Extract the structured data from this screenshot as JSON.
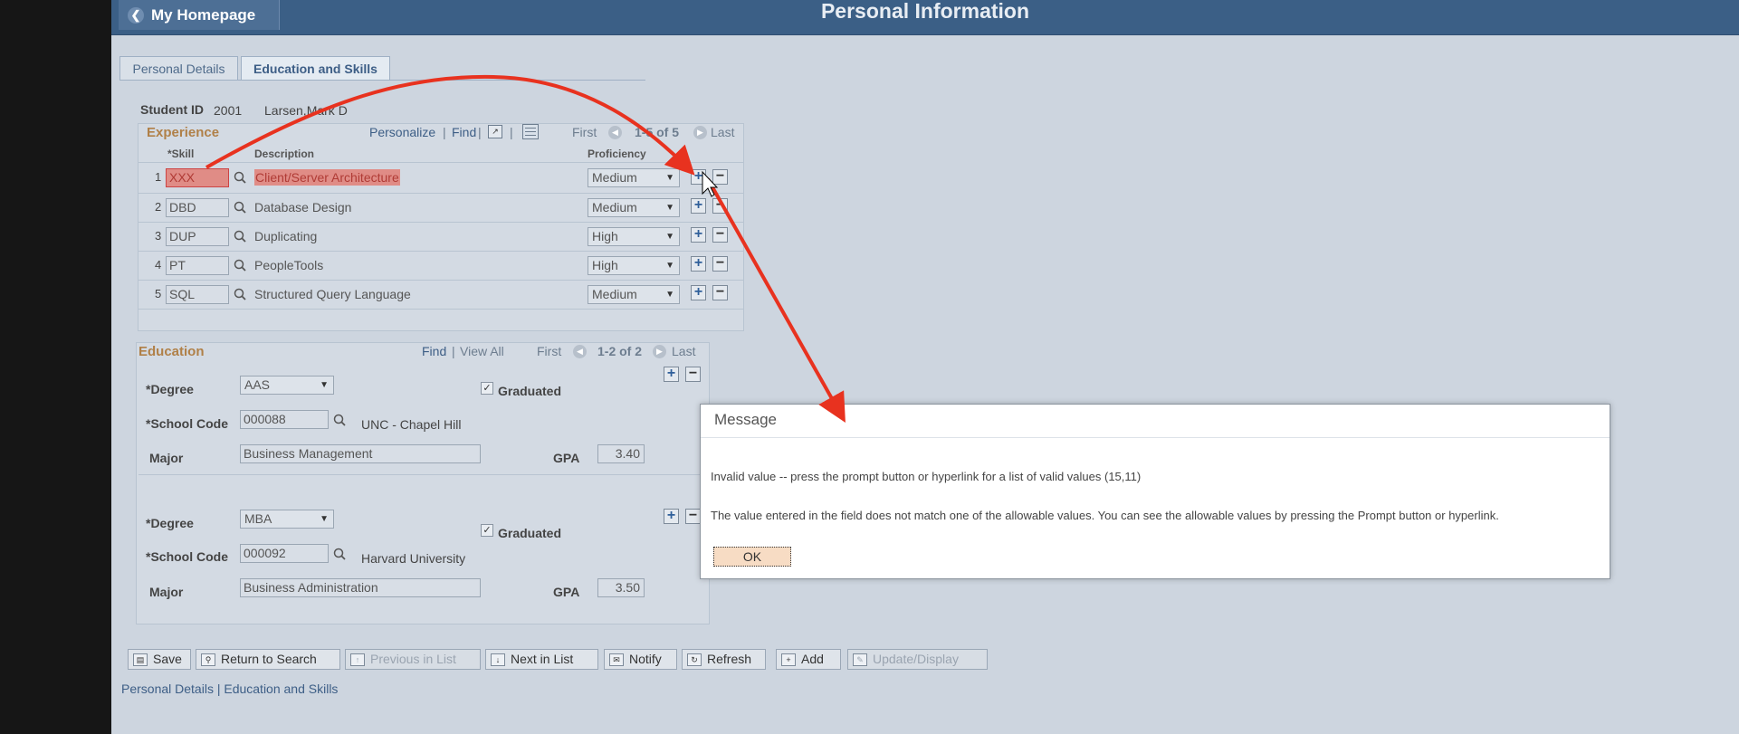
{
  "header": {
    "home_label": "My Homepage",
    "title": "Personal Information"
  },
  "tabs": [
    {
      "label": "Personal Details"
    },
    {
      "label": "Education and Skills"
    }
  ],
  "student": {
    "id_label": "Student ID",
    "id_value": "2001",
    "name": "Larsen,Mark D"
  },
  "experience": {
    "title": "Experience",
    "personalize": "Personalize",
    "find": "Find",
    "first": "First",
    "range": "1-5 of 5",
    "last": "Last",
    "col_skill": "*Skill",
    "col_description": "Description",
    "col_proficiency": "Proficiency",
    "rows": [
      {
        "num": "1",
        "skill": "XXX",
        "description": "Client/Server Architecture",
        "proficiency": "Medium"
      },
      {
        "num": "2",
        "skill": "DBD",
        "description": "Database Design",
        "proficiency": "Medium"
      },
      {
        "num": "3",
        "skill": "DUP",
        "description": "Duplicating",
        "proficiency": "High"
      },
      {
        "num": "4",
        "skill": "PT",
        "description": "PeopleTools",
        "proficiency": "High"
      },
      {
        "num": "5",
        "skill": "SQL",
        "description": "Structured Query Language",
        "proficiency": "Medium"
      }
    ]
  },
  "education": {
    "title": "Education",
    "find": "Find",
    "view_all": "View All",
    "first": "First",
    "range": "1-2 of 2",
    "last": "Last",
    "degree_label": "*Degree",
    "school_label": "*School Code",
    "major_label": "Major",
    "gpa_label": "GPA",
    "graduated_label": "Graduated",
    "records": [
      {
        "degree": "AAS",
        "school_code": "000088",
        "school_name": "UNC - Chapel Hill",
        "major": "Business Management",
        "gpa": "3.40"
      },
      {
        "degree": "MBA",
        "school_code": "000092",
        "school_name": "Harvard University",
        "major": "Business Administration",
        "gpa": "3.50"
      }
    ]
  },
  "toolbar": {
    "save": "Save",
    "return_to_search": "Return to Search",
    "previous_in_list": "Previous in List",
    "next_in_list": "Next in List",
    "notify": "Notify",
    "refresh": "Refresh",
    "add": "Add",
    "update_display": "Update/Display"
  },
  "footer_links": {
    "personal_details": "Personal Details",
    "separator": "|",
    "education_skills": "Education and Skills"
  },
  "dialog": {
    "title": "Message",
    "message1": "Invalid value -- press the prompt button or hyperlink for a list of valid values (15,11)",
    "message2": "The value entered in the field does not match one of the allowable values.  You can see the allowable values by pressing the Prompt button or hyperlink.",
    "ok": "OK"
  },
  "colors": {
    "banner": "#3b5f86",
    "annotation_arrow": "#e8321f",
    "error_field": "#e08c86"
  }
}
